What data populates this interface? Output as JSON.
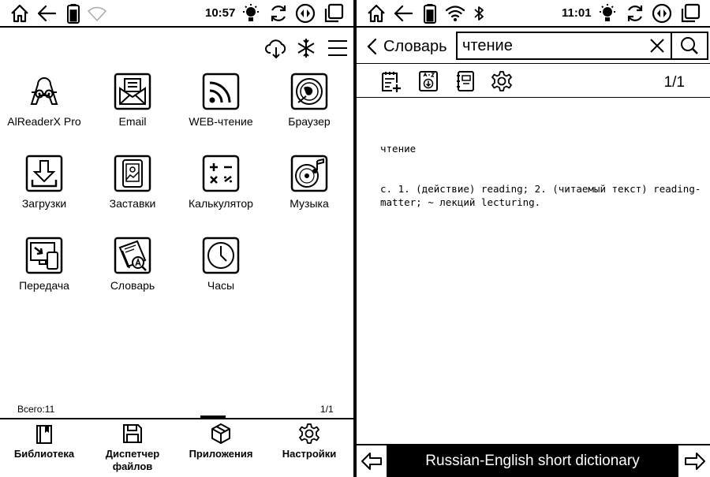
{
  "left_panel": {
    "status_bar": {
      "time": "10:57",
      "battery_level": 0.85
    },
    "toolbar": {
      "icons": [
        "cloud-download-icon",
        "snowflake-icon",
        "menu-icon"
      ]
    },
    "apps": [
      {
        "label": "AlReaderX Pro",
        "icon": "alreader-icon"
      },
      {
        "label": "Email",
        "icon": "email-icon"
      },
      {
        "label": "WEB-чтение",
        "icon": "rss-icon"
      },
      {
        "label": "Браузер",
        "icon": "browser-icon"
      },
      {
        "label": "Загрузки",
        "icon": "downloads-icon"
      },
      {
        "label": "Заставки",
        "icon": "screensaver-icon"
      },
      {
        "label": "Калькулятор",
        "icon": "calculator-icon"
      },
      {
        "label": "Музыка",
        "icon": "music-icon"
      },
      {
        "label": "Передача",
        "icon": "transfer-icon"
      },
      {
        "label": "Словарь",
        "icon": "dictionary-icon"
      },
      {
        "label": "Часы",
        "icon": "clock-icon"
      }
    ],
    "footer": {
      "total": "Всего:11",
      "page": "1/1"
    },
    "bottom_nav": [
      {
        "label": "Библиотека",
        "icon": "library-icon",
        "active": false
      },
      {
        "label": "Диспетчер файлов",
        "icon": "save-icon",
        "active": false
      },
      {
        "label": "Приложения",
        "icon": "box-icon",
        "active": true
      },
      {
        "label": "Настройки",
        "icon": "gear-icon",
        "active": false
      }
    ]
  },
  "right_panel": {
    "status_bar": {
      "time": "11:01",
      "battery_level": 0.85
    },
    "back_label": "Словарь",
    "search": {
      "value": "чтение"
    },
    "toolbar": {
      "icons": [
        "notes-icon",
        "dictionary-download-icon",
        "notebook-icon",
        "settings-icon"
      ]
    },
    "page_indicator": "1/1",
    "entry": {
      "headword": "чтение",
      "definition": "с. 1. (действие) reading; 2. (читаемый текст) reading-matter; ~ лекций lecturing."
    },
    "dictionary_name": "Russian-English short dictionary"
  }
}
